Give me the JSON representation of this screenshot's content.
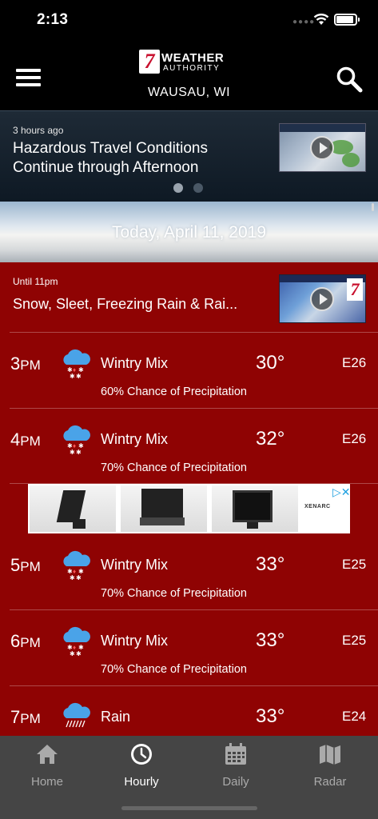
{
  "status": {
    "time": "2:13"
  },
  "header": {
    "logo_line1": "WEATHER",
    "logo_line2": "AUTHORITY",
    "logo_number": "7",
    "location": "WAUSAU, WI"
  },
  "news": {
    "ago": "3 hours ago",
    "headline": "Hazardous Travel Conditions Continue through Afternoon"
  },
  "date_banner": "Today, April 11, 2019",
  "alert": {
    "until": "Until 11pm",
    "text": "Snow, Sleet, Freezing Rain & Rai..."
  },
  "hours": [
    {
      "hour": "3",
      "ampm": "PM",
      "condition": "Wintry Mix",
      "temp": "30°",
      "wind": "E26",
      "precip": "60% Chance of Precipitation",
      "icon": "wintry-mix-icon"
    },
    {
      "hour": "4",
      "ampm": "PM",
      "condition": "Wintry Mix",
      "temp": "32°",
      "wind": "E26",
      "precip": "70% Chance of Precipitation",
      "icon": "wintry-mix-icon"
    },
    {
      "hour": "5",
      "ampm": "PM",
      "condition": "Wintry Mix",
      "temp": "33°",
      "wind": "E25",
      "precip": "70% Chance of Precipitation",
      "icon": "wintry-mix-icon"
    },
    {
      "hour": "6",
      "ampm": "PM",
      "condition": "Wintry Mix",
      "temp": "33°",
      "wind": "E25",
      "precip": "70% Chance of Precipitation",
      "icon": "wintry-mix-icon"
    },
    {
      "hour": "7",
      "ampm": "PM",
      "condition": "Rain",
      "temp": "33°",
      "wind": "E24",
      "precip": "",
      "icon": "rain-icon"
    }
  ],
  "ad": {
    "brand": "XENARC"
  },
  "tabs": [
    {
      "label": "Home",
      "icon": "home-icon",
      "active": false
    },
    {
      "label": "Hourly",
      "icon": "clock-icon",
      "active": true
    },
    {
      "label": "Daily",
      "icon": "calendar-icon",
      "active": false
    },
    {
      "label": "Radar",
      "icon": "map-icon",
      "active": false
    }
  ],
  "colors": {
    "forecast_bg": "#8f0303",
    "tabbar_bg": "#454545",
    "icon_blue": "#4aa3e8"
  }
}
